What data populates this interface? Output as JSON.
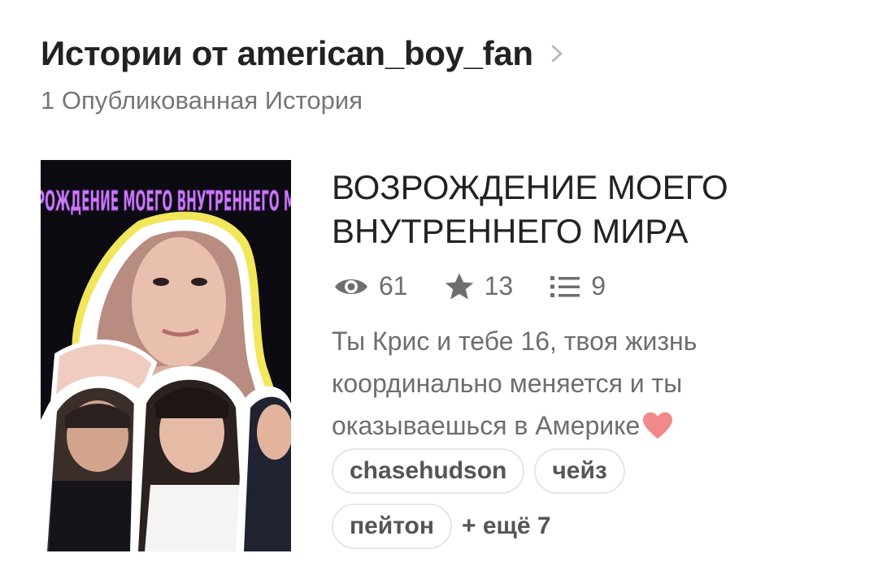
{
  "header": {
    "title": "Истории от american_boy_fan",
    "subtitle": "1 Опубликованная История"
  },
  "story": {
    "cover_text": "РОЖДЕНИЕ МОЕГО ВНУТРЕННЕГО М",
    "title_line1": "ВОЗРОЖДЕНИЕ МОЕГО",
    "title_line2": "ВНУТРЕННЕГО МИРА",
    "stats": {
      "views": "61",
      "votes": "13",
      "parts": "9"
    },
    "description_line1": "Ты Крис и тебе 16, твоя жизнь",
    "description_line2": "координально меняется и ты",
    "description_line3": "оказываешься в Америке",
    "tags": [
      "chasehudson",
      "чейз",
      "пейтон"
    ],
    "more_tags": "+ ещё 7"
  },
  "icons": {
    "chevron": "chevron-right-icon",
    "views": "eye-icon",
    "votes": "star-icon",
    "parts": "list-icon",
    "heart": "heart-emoji"
  },
  "colors": {
    "cover_text": "#c77cf0",
    "heart": "#f08a8a"
  }
}
